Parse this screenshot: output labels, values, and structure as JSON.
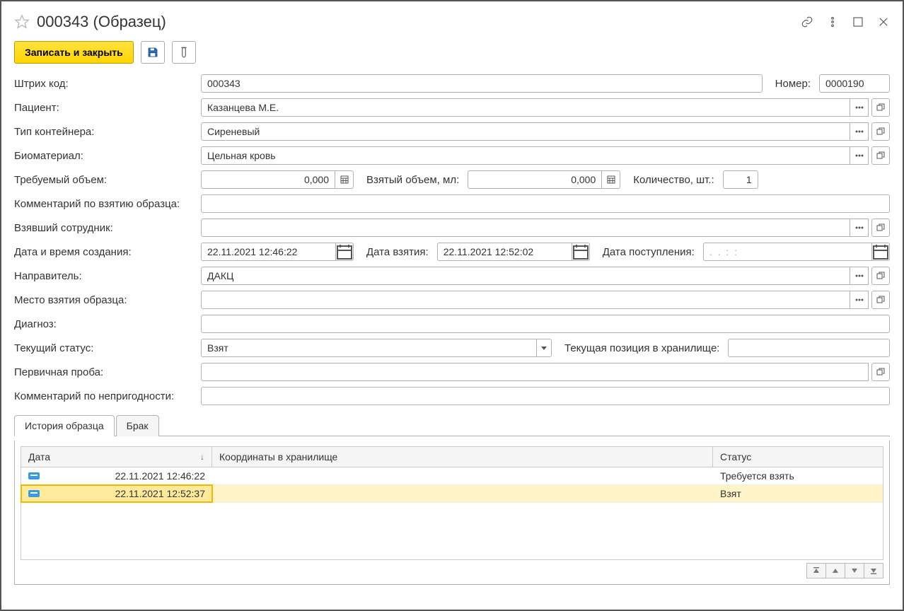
{
  "title": "000343 (Образец)",
  "toolbar": {
    "save_close_label": "Записать и закрыть"
  },
  "labels": {
    "barcode": "Штрих код:",
    "number": "Номер:",
    "patient": "Пациент:",
    "container_type": "Тип контейнера:",
    "biomaterial": "Биоматериал:",
    "required_volume": "Требуемый объем:",
    "taken_volume": "Взятый объем, мл:",
    "quantity": "Количество, шт.:",
    "sampling_comment": "Комментарий по взятию образца:",
    "taking_employee": "Взявший сотрудник:",
    "creation_date": "Дата и время создания:",
    "taken_date": "Дата взятия:",
    "arrival_date": "Дата поступления:",
    "referrer": "Направитель:",
    "sampling_place": "Место взятия образца:",
    "diagnosis": "Диагноз:",
    "current_status": "Текущий статус:",
    "storage_position": "Текущая позиция в хранилище:",
    "primary_sample": "Первичная проба:",
    "reject_comment": "Комментарий по непригодности:"
  },
  "values": {
    "barcode": "000343",
    "number": "0000190",
    "patient": "Казанцева М.Е.",
    "container_type": "Сиреневый",
    "biomaterial": "Цельная кровь",
    "required_volume": "0,000",
    "taken_volume": "0,000",
    "quantity": "1",
    "creation_date": "22.11.2021 12:46:22",
    "taken_date": "22.11.2021 12:52:02",
    "arrival_date_placeholder": ".  .       :  :",
    "referrer": "ДАКЦ",
    "current_status": "Взят"
  },
  "tabs": {
    "history": "История образца",
    "reject": "Брак"
  },
  "history_table": {
    "columns": {
      "date": "Дата",
      "coords": "Координаты в хранилище",
      "status": "Статус"
    },
    "rows": [
      {
        "date": "22.11.2021 12:46:22",
        "coords": "",
        "status": "Требуется взять"
      },
      {
        "date": "22.11.2021 12:52:37",
        "coords": "",
        "status": "Взят"
      }
    ]
  }
}
